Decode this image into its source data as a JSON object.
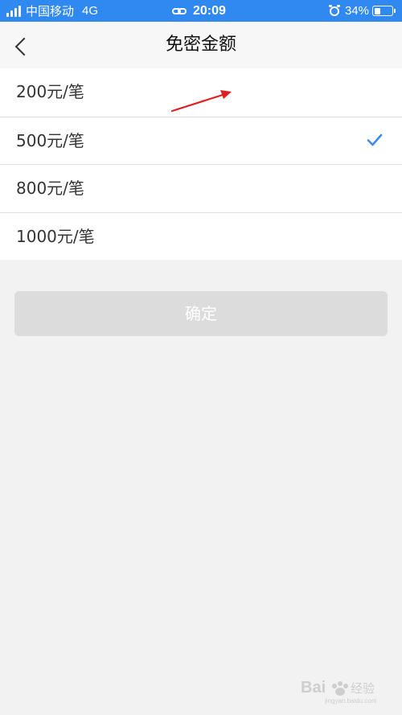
{
  "status_bar": {
    "carrier": "中国移动",
    "network": "4G",
    "time": "20:09",
    "battery_percent": "34%",
    "battery_level": 0.34,
    "signal_bars": 4,
    "icons": [
      "signal-icon",
      "link-icon",
      "alarm-icon",
      "battery-icon"
    ]
  },
  "nav": {
    "back_icon": "chevron-left-icon",
    "title": "免密金额"
  },
  "options": [
    {
      "label": "200元/笔",
      "selected": false
    },
    {
      "label": "500元/笔",
      "selected": true
    },
    {
      "label": "800元/笔",
      "selected": false
    },
    {
      "label": "1000元/笔",
      "selected": false
    }
  ],
  "confirm": {
    "label": "确定",
    "enabled": false
  },
  "annotation": {
    "type": "arrow",
    "color": "#e02020"
  },
  "colors": {
    "status_bar": "#2f89f0",
    "check": "#3b8cf0",
    "page_bg": "#f2f2f2",
    "button_disabled": "#dcdcdc"
  },
  "watermark": {
    "logo_text": "Baidu 经验",
    "sub_text": "jingyan.baidu.com"
  }
}
